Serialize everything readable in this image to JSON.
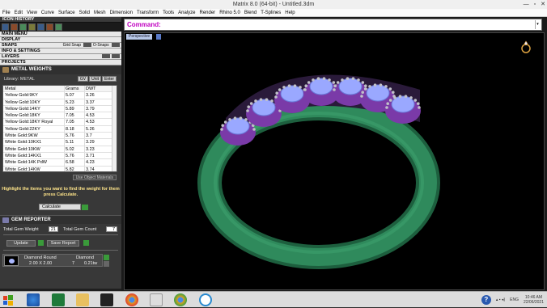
{
  "window": {
    "title": "Matrix 8.0 (64-bit) - Untitled.3dm",
    "minimize": "—",
    "maximize": "▫",
    "close": "✕"
  },
  "menu": [
    "File",
    "Edit",
    "View",
    "Curve",
    "Surface",
    "Solid",
    "Mesh",
    "Dimension",
    "Transform",
    "Tools",
    "Analyze",
    "Render",
    "Rhino 5.0",
    "Blend",
    "T-Splines",
    "Help"
  ],
  "left_panel": {
    "icon_history": "ICON HISTORY",
    "sections": [
      {
        "label": "MAIN MENU"
      },
      {
        "label": "DISPLAY"
      },
      {
        "label": "SNAPS",
        "grid_snap": "Grid Snap",
        "osnaps": "O-Snaps"
      },
      {
        "label": "INFO & SETTINGS"
      },
      {
        "label": "LAYERS"
      },
      {
        "label": "PROJECTS"
      }
    ],
    "metal_weights": {
      "title": "METAL WEIGHTS",
      "library_label": "Library: METAL",
      "lib_buttons": [
        "GV",
        "Unit",
        "Enter"
      ],
      "columns": [
        "Metal",
        "Grams",
        "DWT"
      ],
      "rows": [
        [
          "Yellow Gold:9KY",
          "5.07",
          "3.26"
        ],
        [
          "Yellow Gold:10KY",
          "5.23",
          "3.37"
        ],
        [
          "Yellow Gold:14KY",
          "5.89",
          "3.79"
        ],
        [
          "Yellow Gold:18KY",
          "7.05",
          "4.53"
        ],
        [
          "Yellow Gold:18KY Royal",
          "7.05",
          "4.53"
        ],
        [
          "Yellow Gold:22KY",
          "8.18",
          "5.26"
        ],
        [
          "White Gold:9KW",
          "5.76",
          "3.7"
        ],
        [
          "White Gold:10KX1",
          "5.11",
          "3.29"
        ],
        [
          "White Gold:10KW",
          "5.02",
          "3.23"
        ],
        [
          "White Gold:14KX1",
          "5.76",
          "3.71"
        ],
        [
          "White Gold:14K PdW",
          "6.58",
          "4.23"
        ],
        [
          "White Gold:14KW",
          "5.82",
          "3.74"
        ]
      ],
      "use_object_materials": "Use Object Materials",
      "hint": "Highlight the items you want to find the weight for them press Calculate.",
      "calculate": "Calculate"
    },
    "gem_reporter": {
      "title": "GEM REPORTER",
      "total_gem_weight_label": "Total Gem Weight",
      "total_gem_weight_value": "21",
      "total_gem_count_label": "Total Gem Count",
      "total_gem_count_value": "7",
      "update": "Update",
      "save_report": "Save Report",
      "gem": {
        "shape": "Diamond Round",
        "size": "2.00 X 2.00",
        "type": "Diamond",
        "count": "7",
        "weight": "0.21tw"
      }
    }
  },
  "command": {
    "label": "Command:"
  },
  "viewport": {
    "label": "Perspective"
  },
  "taskbar": {
    "apps": [
      "windows-start",
      "internet-explorer",
      "excel",
      "file-explorer",
      "media",
      "chrome",
      "rhino",
      "chrome-2",
      "matrix"
    ],
    "lang": "ENG",
    "time": "10:46 AM",
    "date": "22/06/2021"
  },
  "colors": {
    "band": "#2f8a5c",
    "gem": "#9aa8ff",
    "setting": "#7a3aa8",
    "command": "#c000c0",
    "hint": "#ffe58a"
  }
}
